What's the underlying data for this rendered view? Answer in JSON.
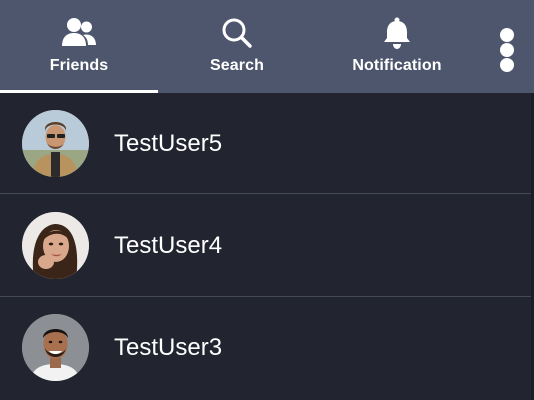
{
  "nav": {
    "tabs": [
      {
        "label": "Friends",
        "icon": "friends-icon",
        "active": true
      },
      {
        "label": "Search",
        "icon": "search-icon",
        "active": false
      },
      {
        "label": "Notification",
        "icon": "bell-icon",
        "active": false
      }
    ],
    "more_icon": "more-vertical-icon"
  },
  "friends": [
    {
      "name": "TestUser5"
    },
    {
      "name": "TestUser4"
    },
    {
      "name": "TestUser3"
    }
  ],
  "colors": {
    "nav_bg": "#4d566d",
    "list_bg": "#22252f",
    "divider": "#444a58",
    "text": "#ffffff"
  }
}
